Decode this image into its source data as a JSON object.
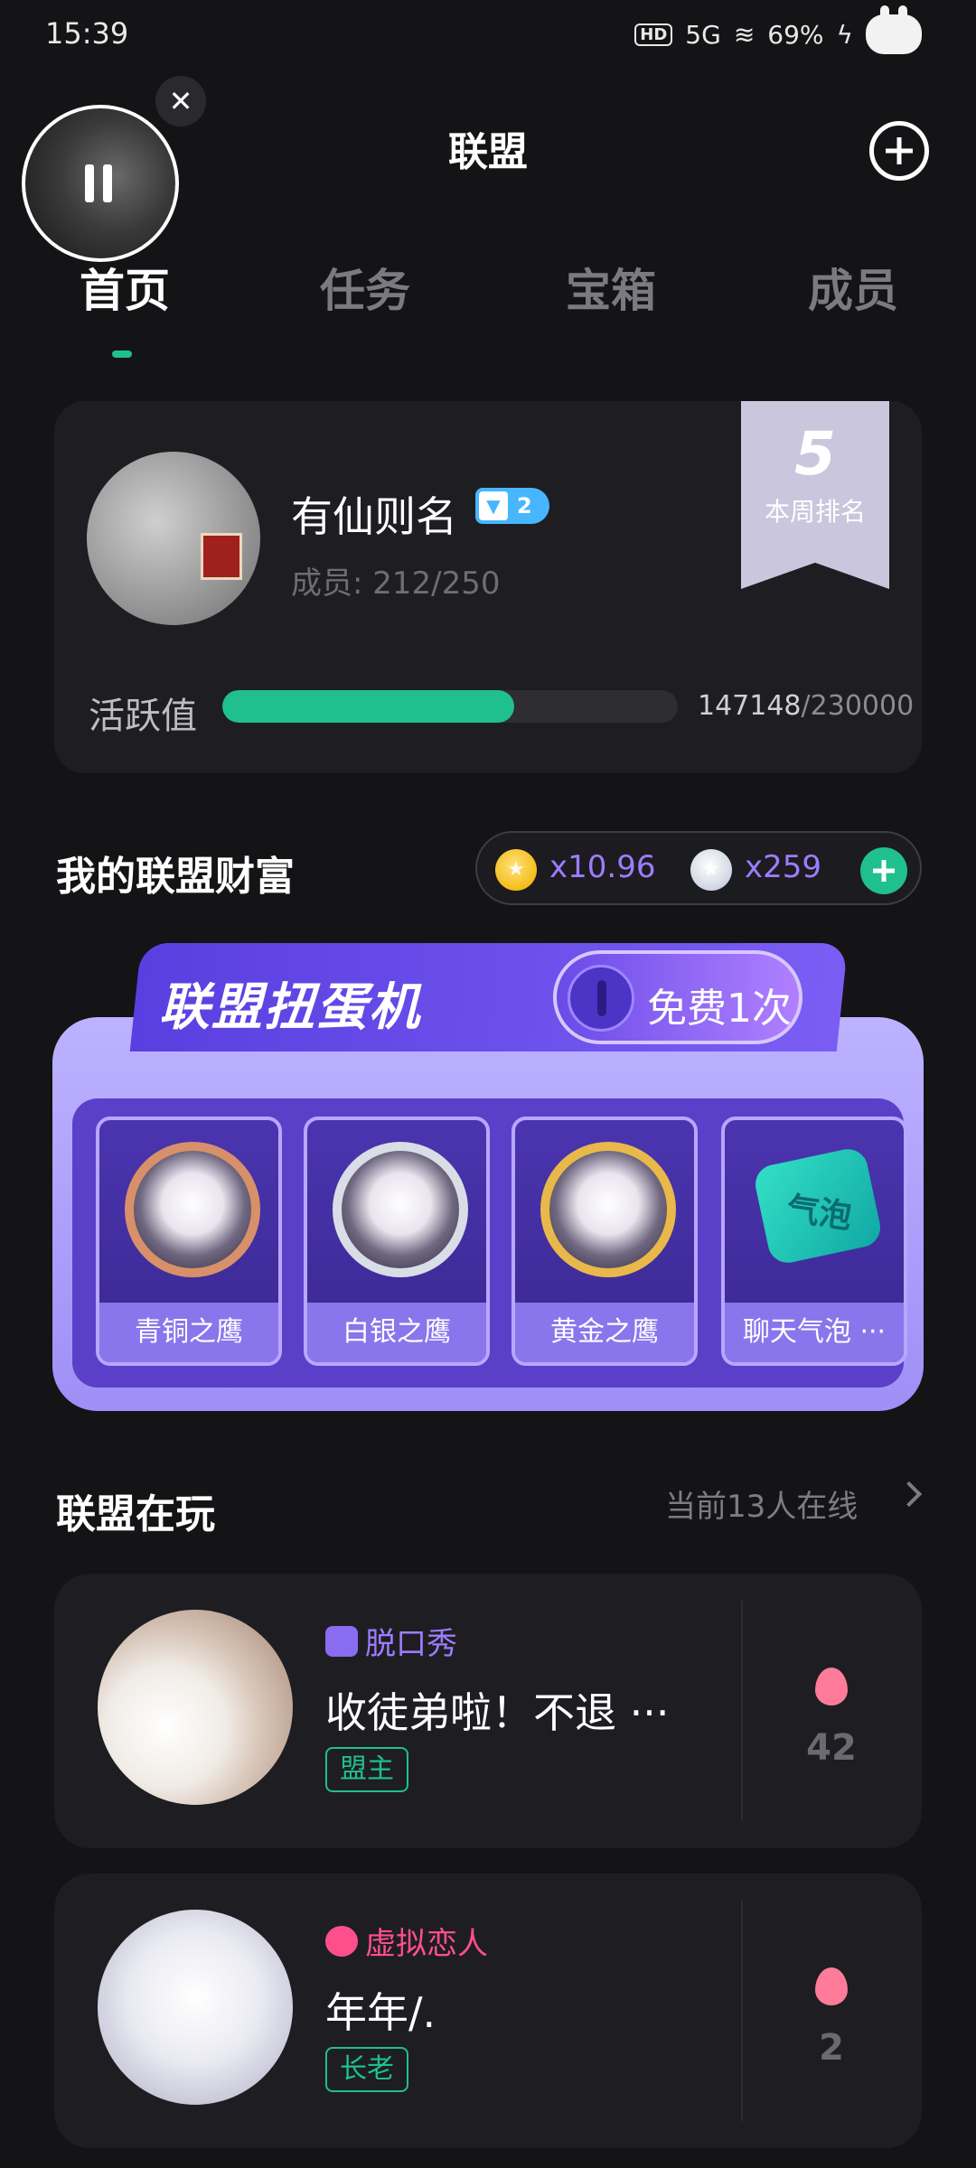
{
  "status_bar": {
    "time": "15:39",
    "hd": "HD",
    "network": "5G",
    "battery": "69%",
    "icons": [
      "hd-icon",
      "signal-icon",
      "wifi-icon",
      "charging-icon",
      "bunny-icon"
    ]
  },
  "header": {
    "title": "联盟",
    "add_icon": "plus-circle-icon"
  },
  "tabs": [
    "首页",
    "任务",
    "宝箱",
    "成员"
  ],
  "active_tab": 0,
  "alliance": {
    "name": "有仙则名",
    "level": "2",
    "members": "成员: 212/250",
    "weekly_rank": "5",
    "weekly_rank_label": "本周排名",
    "activity_label": "活跃值",
    "activity_current": "147148",
    "activity_total": "/230000",
    "activity_progress": 0.64
  },
  "wealth": {
    "title": "我的联盟财富",
    "gold": "x10.96",
    "silver": "x259"
  },
  "gacha": {
    "title": "联盟扭蛋机",
    "free_label": "免费1次",
    "prizes": [
      {
        "label": "青铜之鹰"
      },
      {
        "label": "白银之鹰"
      },
      {
        "label": "黄金之鹰"
      },
      {
        "label": "聊天气泡 ···",
        "badge": "气泡"
      }
    ]
  },
  "playing": {
    "title": "联盟在玩",
    "online": "当前13人在线",
    "rooms": [
      {
        "tag": "脱口秀",
        "tag_color": "#9d7dff",
        "title": "收徒弟啦！不退 ···",
        "role": "盟主",
        "heat": "42"
      },
      {
        "tag": "虚拟恋人",
        "tag_color": "#ff4f8b",
        "title": "年年/.",
        "role": "长老",
        "heat": "2"
      }
    ]
  },
  "colors": {
    "accent": "#1fc08b",
    "purple": "#9d7dff",
    "pink": "#ff4f8b",
    "background": "#141417"
  }
}
